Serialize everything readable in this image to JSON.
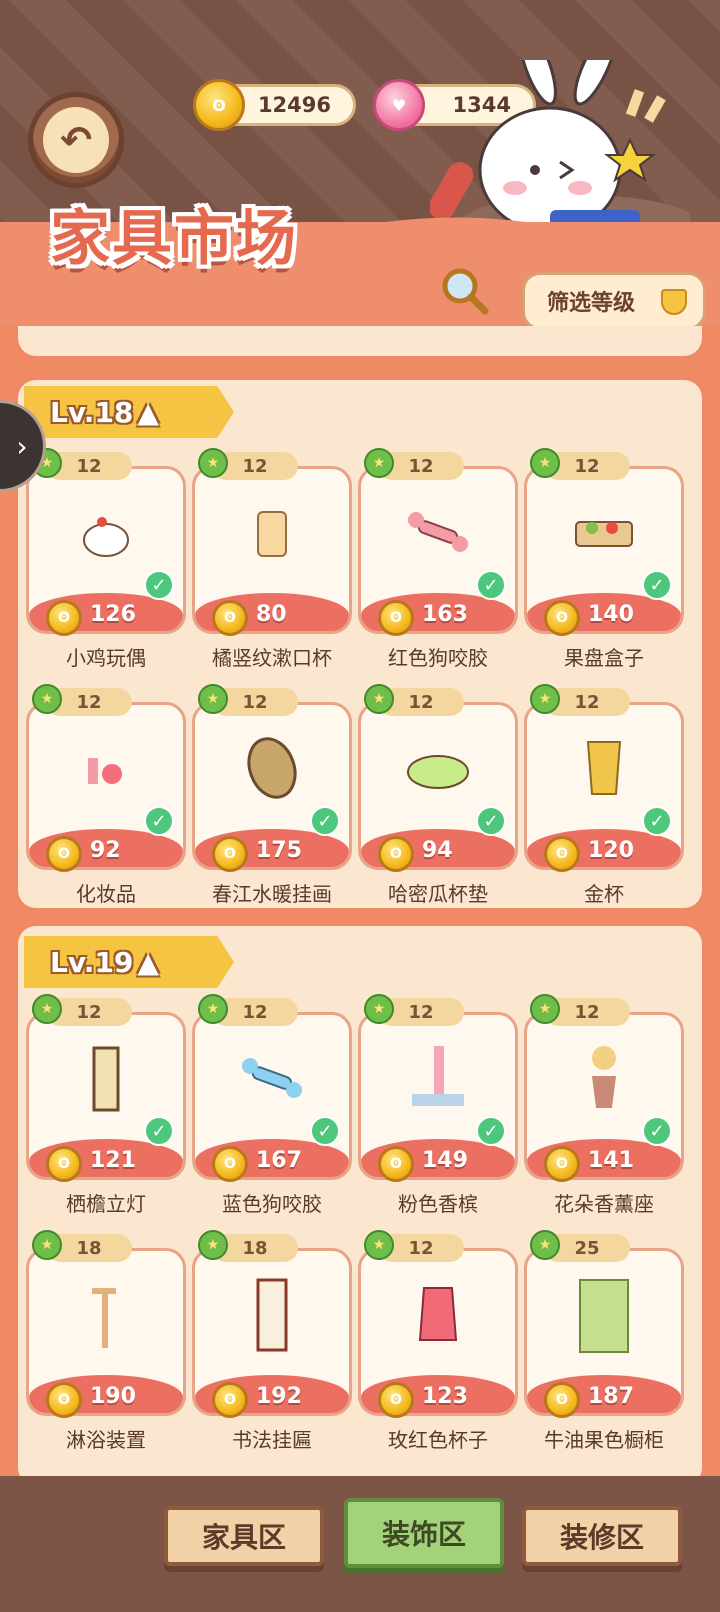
{
  "header": {
    "back_icon": "back-arrow-icon",
    "coins": "12496",
    "hearts": "1344",
    "title": "家具市场",
    "filter_label": "筛选等级"
  },
  "sections": [
    {
      "level_label": "Lv.18",
      "items": [
        {
          "level": "12",
          "price": "126",
          "name": "小鸡玩偶",
          "owned": true,
          "icon": "chicken-doll"
        },
        {
          "level": "12",
          "price": "80",
          "name": "橘竖纹漱口杯",
          "owned": false,
          "icon": "cup"
        },
        {
          "level": "12",
          "price": "163",
          "name": "红色狗咬胶",
          "owned": true,
          "icon": "red-bone"
        },
        {
          "level": "12",
          "price": "140",
          "name": "果盘盒子",
          "owned": true,
          "icon": "fruit-box"
        },
        {
          "level": "12",
          "price": "92",
          "name": "化妆品",
          "owned": true,
          "icon": "cosmetics"
        },
        {
          "level": "12",
          "price": "175",
          "name": "春江水暖挂画",
          "owned": true,
          "icon": "painting"
        },
        {
          "level": "12",
          "price": "94",
          "name": "哈密瓜杯垫",
          "owned": true,
          "icon": "melon-coaster"
        },
        {
          "level": "12",
          "price": "120",
          "name": "金杯",
          "owned": true,
          "icon": "gold-cup"
        }
      ]
    },
    {
      "level_label": "Lv.19",
      "items": [
        {
          "level": "12",
          "price": "121",
          "name": "栖檐立灯",
          "owned": true,
          "icon": "lamp"
        },
        {
          "level": "12",
          "price": "167",
          "name": "蓝色狗咬胶",
          "owned": true,
          "icon": "blue-bone"
        },
        {
          "level": "12",
          "price": "149",
          "name": "粉色香槟",
          "owned": true,
          "icon": "champagne"
        },
        {
          "level": "12",
          "price": "141",
          "name": "花朵香薰座",
          "owned": true,
          "icon": "flower-vase"
        },
        {
          "level": "18",
          "price": "190",
          "name": "淋浴装置",
          "owned": false,
          "icon": "shower"
        },
        {
          "level": "18",
          "price": "192",
          "name": "书法挂匾",
          "owned": false,
          "icon": "calligraphy"
        },
        {
          "level": "12",
          "price": "123",
          "name": "玫红色杯子",
          "owned": false,
          "icon": "rose-cup"
        },
        {
          "level": "25",
          "price": "187",
          "name": "牛油果色橱柜",
          "owned": false,
          "icon": "cabinet"
        }
      ]
    }
  ],
  "bottom_nav": {
    "tabs": [
      {
        "label": "家具区",
        "active": false
      },
      {
        "label": "装饰区",
        "active": true
      },
      {
        "label": "装修区",
        "active": false
      }
    ]
  }
}
